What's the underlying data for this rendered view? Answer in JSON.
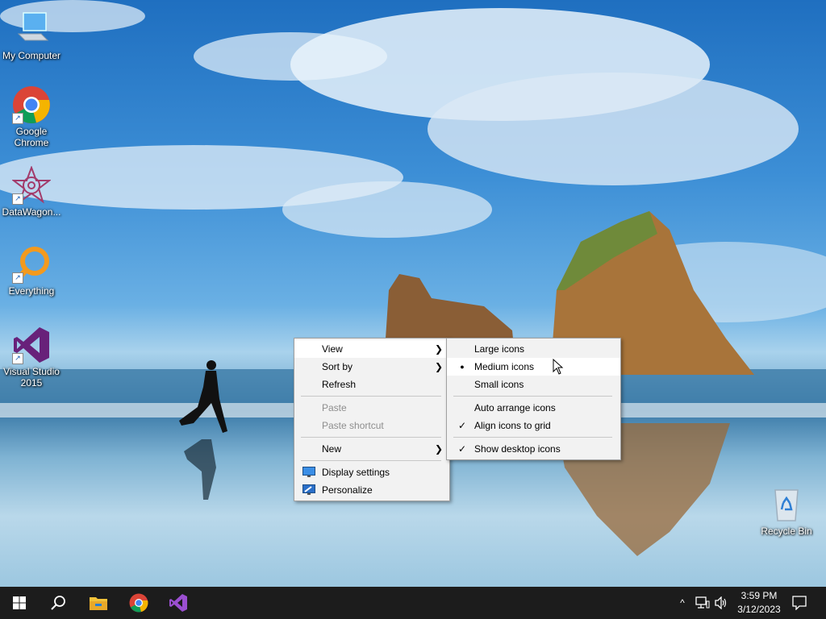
{
  "desktop_icons": [
    {
      "label": "My Computer",
      "icon": "computer-icon",
      "shortcut": false
    },
    {
      "label": "Google Chrome",
      "icon": "chrome-icon",
      "shortcut": true
    },
    {
      "label": "DataWagon...",
      "icon": "datawagon-icon",
      "shortcut": true
    },
    {
      "label": "Everything",
      "icon": "everything-search-icon",
      "shortcut": true
    },
    {
      "label": "Visual Studio 2015",
      "icon": "visual-studio-icon",
      "shortcut": true
    },
    {
      "label": "Recycle Bin",
      "icon": "recycle-bin-icon",
      "shortcut": false
    }
  ],
  "context_menu": {
    "view": "View",
    "sort_by": "Sort by",
    "refresh": "Refresh",
    "paste": "Paste",
    "paste_shortcut": "Paste shortcut",
    "new": "New",
    "display_settings": "Display settings",
    "personalize": "Personalize",
    "arrow": ">"
  },
  "view_submenu": {
    "large_icons": "Large icons",
    "medium_icons": "Medium icons",
    "small_icons": "Small icons",
    "auto_arrange": "Auto arrange icons",
    "align_to_grid": "Align icons to grid",
    "show_desktop_icons": "Show desktop icons",
    "selected_bullet": "●",
    "check": "✓"
  },
  "taskbar": {
    "start": "windows-start-icon",
    "search": "search-icon",
    "pinned": [
      "file-explorer-icon",
      "chrome-icon",
      "visual-studio-icon"
    ],
    "tray": {
      "chevron": "^",
      "time": "3:59 PM",
      "date": "3/12/2023"
    }
  },
  "colors": {
    "menu_bg": "#f2f2f2",
    "menu_hover": "#ffffff",
    "disabled_text": "#8e8e8e",
    "taskbar_bg": "#1c1c1c"
  }
}
